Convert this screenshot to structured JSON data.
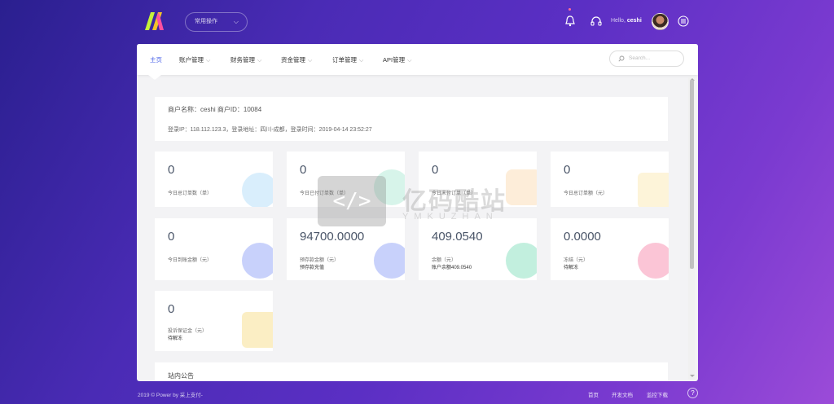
{
  "header": {
    "quick_menu": "常用操作",
    "hello_prefix": "Hello,",
    "username": "ceshi",
    "icons": [
      "bell-icon",
      "headset-icon",
      "avatar",
      "menu-icon"
    ]
  },
  "nav": {
    "items": [
      {
        "label": "主页",
        "active": true
      },
      {
        "label": "账户管理"
      },
      {
        "label": "财务管理"
      },
      {
        "label": "资金管理"
      },
      {
        "label": "订单管理"
      },
      {
        "label": "API管理"
      }
    ],
    "search_placeholder": "Search..."
  },
  "info": {
    "line1": "商户名称：ceshi  商户ID：10084",
    "line2": "登录IP：118.112.123.3，登录地址：四川-成都，登录时间：2019-04-14 23:52:27"
  },
  "cards": [
    {
      "value": "0",
      "label": "今日总订单数（单）",
      "sub": ""
    },
    {
      "value": "0",
      "label": "今日已付订单数（单）",
      "sub": ""
    },
    {
      "value": "0",
      "label": "今日未付订单（单）",
      "sub": ""
    },
    {
      "value": "0",
      "label": "今日总订单额（元）",
      "sub": ""
    },
    {
      "value": "0",
      "label": "今日到账金额（元）",
      "sub": ""
    },
    {
      "value": "94700.0000",
      "label": "预存款金额（元）",
      "sub": "预存款充值"
    },
    {
      "value": "409.0540",
      "label": "余额（元）",
      "sub": "账户余额409.0540"
    },
    {
      "value": "0.0000",
      "label": "冻结（元）",
      "sub": "待解冻"
    },
    {
      "value": "0",
      "label": "投诉保证金（元）",
      "sub": "待解冻"
    }
  ],
  "notice_title": "站内公告",
  "watermark": {
    "line1": "亿码酷站",
    "line2": "YMKUZHAN"
  },
  "footer": {
    "copyright": "2019 © Power by 采上支付-",
    "links": [
      "首页",
      "开发文档",
      "监控下载"
    ]
  },
  "colors": {
    "accent": "#4b63e8",
    "bg_start": "#2a1f8f",
    "bg_end": "#9b4bd8"
  }
}
